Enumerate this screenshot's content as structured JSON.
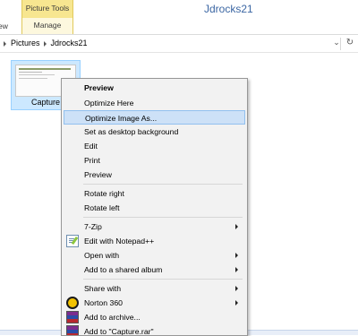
{
  "window": {
    "context_tab": "Picture Tools",
    "title": "Jdrocks21"
  },
  "ribbon": {
    "tab_view_partial": "ew",
    "tab_manage": "Manage"
  },
  "address": {
    "crumbs": [
      "Pictures",
      "Jdrocks21"
    ],
    "dropdown_icon": "chevron-down-icon",
    "refresh_icon": "refresh-icon"
  },
  "file": {
    "name": "Capture"
  },
  "context_menu": {
    "items": [
      {
        "label": "Preview",
        "bold": true
      },
      {
        "label": "Optimize Here"
      },
      {
        "label": "Optimize Image As...",
        "highlighted": true
      },
      {
        "label": "Set as desktop background"
      },
      {
        "label": "Edit"
      },
      {
        "label": "Print"
      },
      {
        "label": "Preview"
      },
      {
        "label": "Rotate right"
      },
      {
        "label": "Rotate left"
      },
      {
        "label": "7-Zip",
        "submenu": true
      },
      {
        "label": "Edit with Notepad++",
        "icon": "notepad-plus-plus-icon"
      },
      {
        "label": "Open with",
        "submenu": true
      },
      {
        "label": "Add to a shared album",
        "submenu": true
      },
      {
        "label": "Share with",
        "submenu": true
      },
      {
        "label": "Norton 360",
        "icon": "norton-icon",
        "submenu": true
      },
      {
        "label": "Add to archive...",
        "icon": "winrar-icon"
      },
      {
        "label": "Add to \"Capture.rar\"",
        "icon": "winrar-icon"
      }
    ]
  },
  "colors": {
    "context_tab": "#f7e690",
    "title_text": "#3b66a3",
    "selection": "#cce8ff",
    "menu_highlight": "#cde1f7"
  }
}
